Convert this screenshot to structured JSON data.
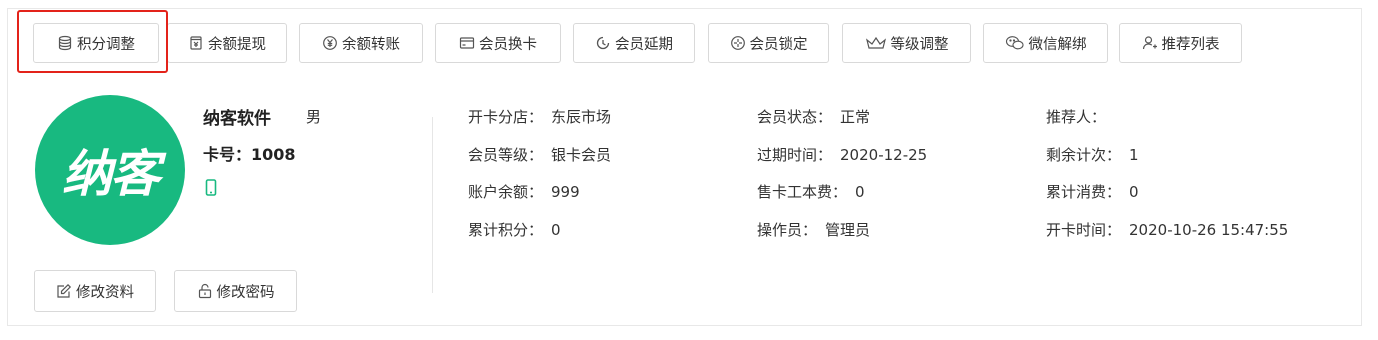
{
  "toolbar": {
    "buttons": [
      {
        "label": "积分调整",
        "icon": "database-icon"
      },
      {
        "label": "余额提现",
        "icon": "wallet-icon"
      },
      {
        "label": "余额转账",
        "icon": "yen-icon"
      },
      {
        "label": "会员换卡",
        "icon": "card-icon"
      },
      {
        "label": "会员延期",
        "icon": "clock-icon"
      },
      {
        "label": "会员锁定",
        "icon": "compass-icon"
      },
      {
        "label": "等级调整",
        "icon": "crown-icon"
      },
      {
        "label": "微信解绑",
        "icon": "wechat-icon"
      },
      {
        "label": "推荐列表",
        "icon": "user-add-icon"
      }
    ],
    "highlight_color": "#e3231a"
  },
  "member": {
    "avatar_text": "纳客",
    "avatar_color": "#18b980",
    "name": "纳客软件",
    "gender": "男",
    "card_label": "卡号：",
    "card_number": "1008",
    "phone_icon": "mobile-icon",
    "phone_icon_color": "#18b980",
    "edit_profile_label": "修改资料",
    "change_password_label": "修改密码"
  },
  "details": {
    "col1": [
      {
        "key": "开卡分店：",
        "value": "东辰市场"
      },
      {
        "key": "会员等级：",
        "value": "银卡会员"
      },
      {
        "key": "账户余额：",
        "value": "999"
      },
      {
        "key": "累计积分：",
        "value": "0"
      }
    ],
    "col2": [
      {
        "key": "会员状态：",
        "value": "正常"
      },
      {
        "key": "过期时间：",
        "value": "2020-12-25"
      },
      {
        "key": "售卡工本费：",
        "value": "0"
      },
      {
        "key": "操作员：",
        "value": "管理员"
      }
    ],
    "col3": [
      {
        "key": "推荐人：",
        "value": ""
      },
      {
        "key": "剩余计次：",
        "value": "1"
      },
      {
        "key": "累计消费：",
        "value": "0"
      },
      {
        "key": "开卡时间：",
        "value": "2020-10-26 15:47:55"
      }
    ]
  }
}
